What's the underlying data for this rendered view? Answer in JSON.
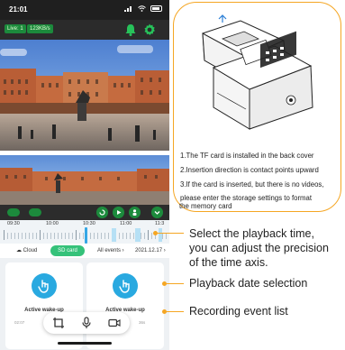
{
  "status_bar": {
    "time": "21:01",
    "signal": "signal-icon",
    "wifi": "wifi-icon",
    "battery": "battery-icon"
  },
  "top_bar": {
    "live_label": "Live: 1",
    "rate_label": "123KB/s",
    "bell": "bell-icon",
    "settings": "gear-icon"
  },
  "timeline": {
    "tick_labels": [
      "09:30",
      "10:00",
      "10:30",
      "11:00",
      "11:3"
    ]
  },
  "tabs": {
    "cloud": "Cloud",
    "sd_card": "SD card",
    "all_events": "All events",
    "date": "2021.12.17"
  },
  "cards": [
    {
      "title": "Active wake-up",
      "time": "02:07"
    },
    {
      "title": "Active wake-up",
      "time": "36s"
    }
  ],
  "notes": [
    "1.The TF card is installed in the back cover",
    "2.Insertion direction is contact points upward",
    "3.If the card is inserted, but there is no videos,",
    "please enter the storage settings to format",
    "the memory card"
  ],
  "callouts": {
    "timeline": [
      "Select the playback time,",
      "you can adjust the precision",
      "of the time axis."
    ],
    "date": "Playback date selection",
    "events": "Recording event list"
  },
  "colors": {
    "accent_orange": "#f5a623",
    "green": "#1c8a3c",
    "blue": "#29a9e0",
    "sd_tab": "#35c27a"
  }
}
